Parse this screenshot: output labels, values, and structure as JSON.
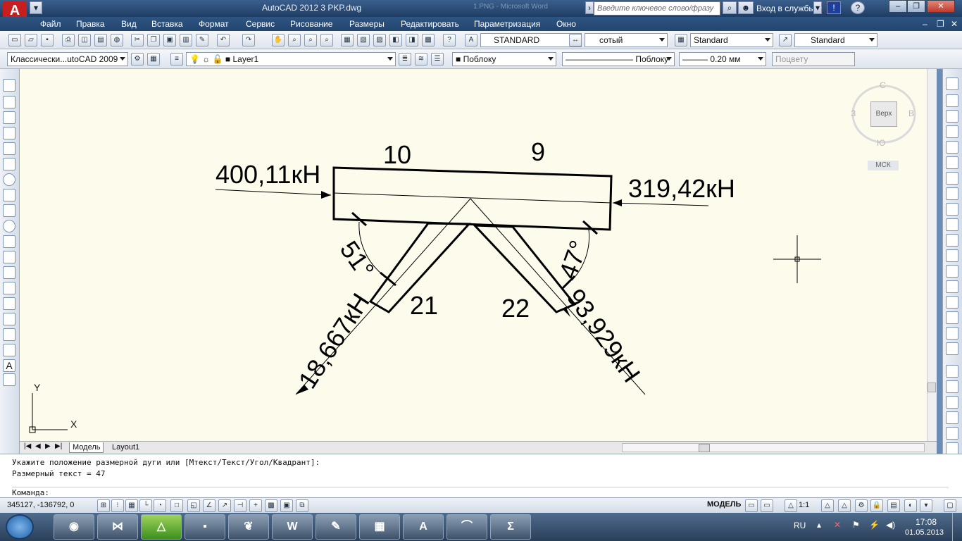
{
  "window": {
    "title": "AutoCAD 2012    3 PKP.dwg",
    "ghost_title": "1.PNG  -  Microsoft Word",
    "search_placeholder": "Введите ключевое слово/фразу",
    "login_label": "Вход в службы",
    "help_label": "?"
  },
  "menu": [
    "Файл",
    "Правка",
    "Вид",
    "Вставка",
    "Формат",
    "Сервис",
    "Рисование",
    "Размеры",
    "Редактировать",
    "Параметризация",
    "Окно"
  ],
  "toolbar1": {
    "text_style": "STANDARD",
    "dim_style": "сотый",
    "table_style": "Standard",
    "mleader_style": "Standard"
  },
  "toolbar2": {
    "workspace": "Классически...utoCAD 2009",
    "layer": "Layer1",
    "color": "Поблоку",
    "linetype": "Поблоку",
    "lineweight": "0.20 мм",
    "plotstyle": "Поцвету"
  },
  "viewcube": {
    "face": "Верх",
    "north": "С",
    "south": "Ю",
    "west": "З",
    "east": "В",
    "wcs": "МСК"
  },
  "drawing": {
    "labels": {
      "left_force": "400,11кН",
      "right_force": "319,42кН",
      "seg10": "10",
      "seg9": "9",
      "seg21": "21",
      "seg22": "22",
      "left_angle": "51°",
      "right_angle": "47°",
      "left_diag_force": "18,667кН",
      "right_diag_force": "93,929кН"
    },
    "ucs": {
      "x": "X",
      "y": "Y"
    }
  },
  "tabs": [
    "Модель",
    "Layout1"
  ],
  "command": {
    "line1": "Укажите положение размерной дуги или [Мтекст/Текст/Угол/Квадрант]:",
    "line2": "Размерный текст = 47",
    "prompt": "Команда:"
  },
  "status": {
    "coords": "345127, -136792, 0",
    "model": "МОДЕЛЬ",
    "scale": "1:1"
  },
  "taskbar": {
    "lang": "RU",
    "time": "17:08",
    "date": "01.05.2013"
  }
}
